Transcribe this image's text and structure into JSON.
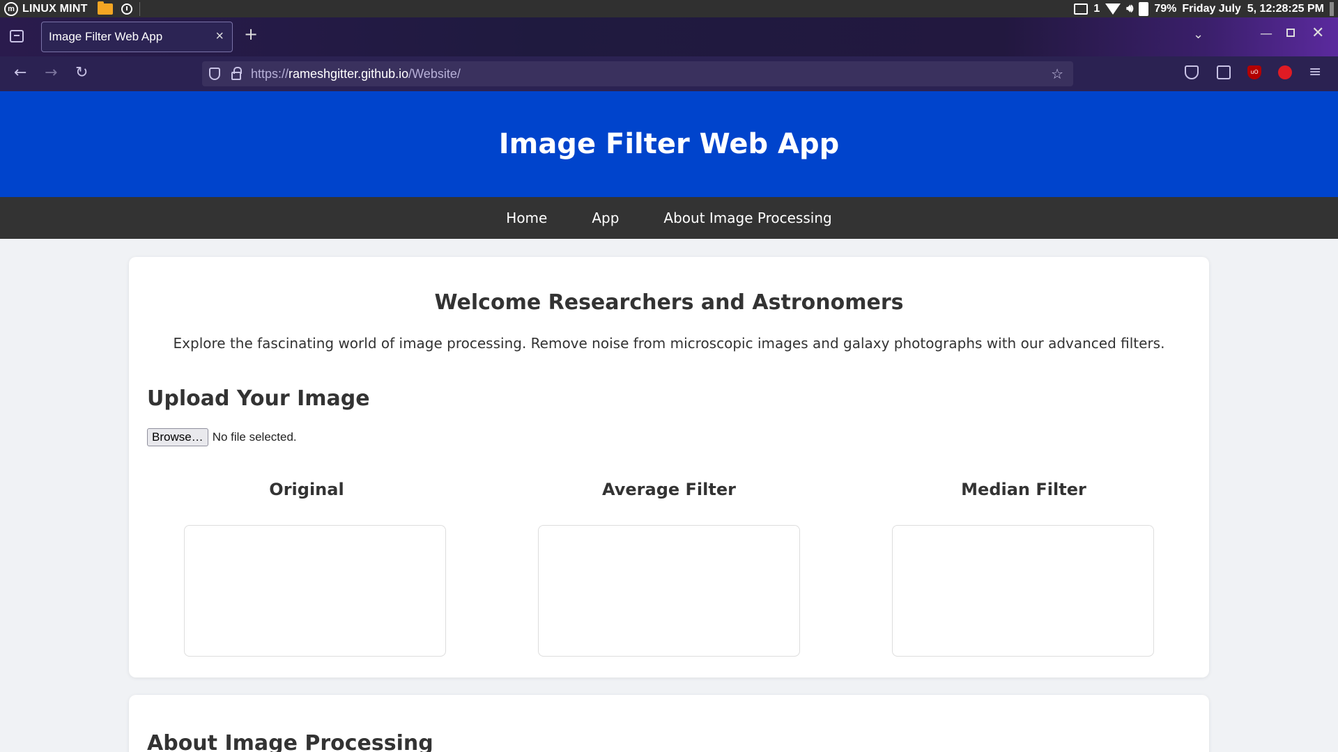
{
  "os_panel": {
    "brand": "LINUX MINT",
    "printer_count": "1",
    "battery": "79%",
    "datetime": "Friday July  5, 12:28:25 PM"
  },
  "browser": {
    "tab_title": "Image Filter Web App",
    "url_scheme": "https://",
    "url_host": "rameshgitter.github.io",
    "url_path": "/Website/"
  },
  "site": {
    "title": "Image Filter Web App",
    "nav": [
      "Home",
      "App",
      "About Image Processing"
    ]
  },
  "main": {
    "welcome_heading": "Welcome Researchers and Astronomers",
    "intro_text": "Explore the fascinating world of image processing. Remove noise from microscopic images and galaxy photographs with our advanced filters.",
    "upload_heading": "Upload Your Image",
    "browse_label": "Browse…",
    "file_status": "No file selected.",
    "columns": [
      "Original",
      "Average Filter",
      "Median Filter"
    ]
  },
  "about": {
    "heading": "About Image Processing"
  },
  "colors": {
    "header_blue": "#0044cc",
    "nav_dark": "#333333",
    "browser_purple": "#2b2252"
  }
}
